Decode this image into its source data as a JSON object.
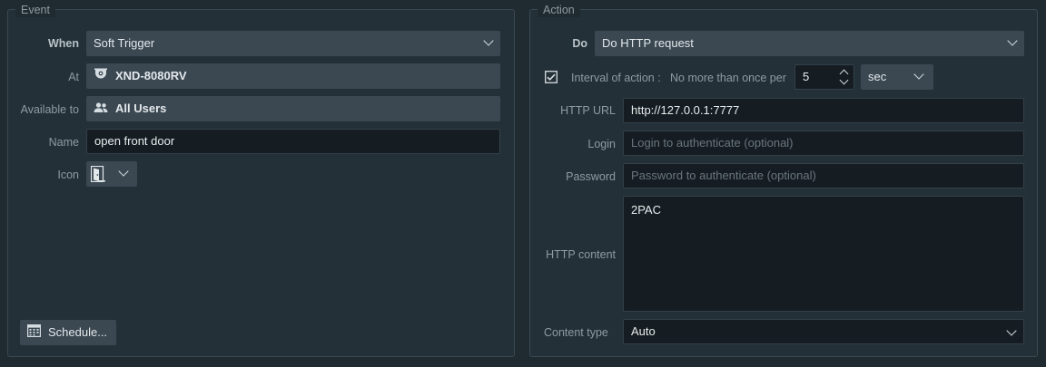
{
  "event": {
    "title": "Event",
    "when_label": "When",
    "when_value": "Soft Trigger",
    "at_label": "At",
    "at_value": "XND-8080RV",
    "available_label": "Available to",
    "available_value": "All Users",
    "name_label": "Name",
    "name_value": "open front door",
    "icon_label": "Icon",
    "schedule_button": "Schedule..."
  },
  "action": {
    "title": "Action",
    "do_label": "Do",
    "do_value": "Do HTTP request",
    "interval_label": "Interval of action :",
    "interval_prefix": "No more than once per",
    "interval_value": "5",
    "interval_unit": "sec",
    "interval_checked": true,
    "url_label": "HTTP URL",
    "url_value": "http://127.0.0.1:7777",
    "login_label": "Login",
    "login_placeholder": "Login to authenticate (optional)",
    "password_label": "Password",
    "password_placeholder": "Password to authenticate (optional)",
    "content_label": "HTTP content",
    "content_value": "2PAC",
    "content_type_label": "Content type",
    "content_type_value": "Auto"
  },
  "icons": {
    "camera": "camera-icon",
    "users": "users-icon",
    "door": "door-icon",
    "calendar": "calendar-icon",
    "check": "checkbox-icon",
    "chevron": "chevron-down-icon"
  },
  "colors": {
    "background": "#1f2a31",
    "panel": "#243038",
    "field": "#3b4852",
    "input": "#161d22"
  }
}
